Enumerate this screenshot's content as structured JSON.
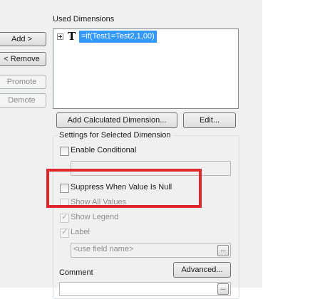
{
  "used_dimensions": {
    "label": "Used Dimensions",
    "items": [
      {
        "type_icon": "T",
        "expression": "=if(Test1=Test2,1,00)"
      }
    ]
  },
  "left_buttons": {
    "add": "Add >",
    "remove": "< Remove",
    "promote": "Promote",
    "demote": "Demote"
  },
  "actions": {
    "add_calculated_dimension": "Add Calculated Dimension...",
    "edit": "Edit..."
  },
  "settings": {
    "legend": "Settings for Selected Dimension",
    "enable_conditional": "Enable Conditional",
    "suppress_null": "Suppress When Value Is Null",
    "show_all_values": "Show All Values",
    "show_legend": "Show Legend",
    "label": "Label",
    "label_placeholder": "<use field name>",
    "ellipsis": "...",
    "comment": "Comment",
    "advanced": "Advanced..."
  },
  "colors": {
    "selection": "#3399ff",
    "highlight": "#e0262d"
  }
}
